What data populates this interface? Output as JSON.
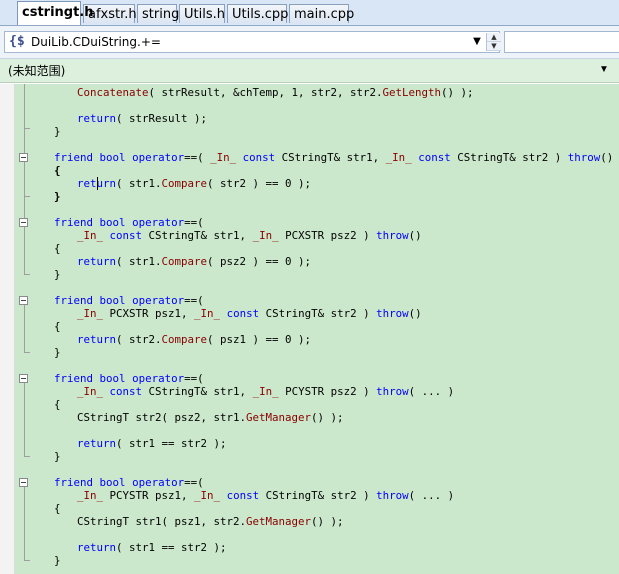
{
  "tabs": [
    {
      "label": "cstringt.h",
      "active": true
    },
    {
      "label": "afxstr.h",
      "active": false
    },
    {
      "label": "string",
      "active": false
    },
    {
      "label": "Utils.h",
      "active": false
    },
    {
      "label": "Utils.cpp",
      "active": false
    },
    {
      "label": "main.cpp",
      "active": false
    }
  ],
  "nav": {
    "scope_icon": "{$",
    "scope_value": "DuiLib.CDuiString.+=",
    "member_value": ""
  },
  "scope_bar": {
    "text": "(未知范围)"
  },
  "colors": {
    "editor_bg": "#cce8cc",
    "keyword": "#0000ff",
    "function": "#880000",
    "sal_macro": "#8b0000"
  },
  "code_lines": {
    "l01": {
      "text": "Concatenate( strResult, &chTemp, 1, str2, str2.GetLength() );"
    },
    "l02": {
      "text": "return( strResult );"
    },
    "l03": {
      "text": "}"
    },
    "l04": {
      "text": "friend bool operator==( _In_ const CStringT& str1, _In_ const CStringT& str2 ) throw()"
    },
    "l05": {
      "text": "{"
    },
    "l06": {
      "text": "return( str1.Compare( str2 ) == 0 );"
    },
    "l07": {
      "text": "}"
    },
    "l08": {
      "text": "friend bool operator==("
    },
    "l09": {
      "text": "_In_ const CStringT& str1, _In_ PCXSTR psz2 ) throw()"
    },
    "l10": {
      "text": "{"
    },
    "l11": {
      "text": "return( str1.Compare( psz2 ) == 0 );"
    },
    "l12": {
      "text": "}"
    },
    "l13": {
      "text": "friend bool operator==("
    },
    "l14": {
      "text": "_In_ PCXSTR psz1, _In_ const CStringT& str2 ) throw()"
    },
    "l15": {
      "text": "{"
    },
    "l16": {
      "text": "return( str2.Compare( psz1 ) == 0 );"
    },
    "l17": {
      "text": "}"
    },
    "l18": {
      "text": "friend bool operator==("
    },
    "l19": {
      "text": "_In_ const CStringT& str1, _In_ PCYSTR psz2 ) throw( ... )"
    },
    "l20": {
      "text": "{"
    },
    "l21": {
      "text": "CStringT str2( psz2, str1.GetManager() );"
    },
    "l22": {
      "text": "return( str1 == str2 );"
    },
    "l23": {
      "text": "}"
    },
    "l24": {
      "text": "friend bool operator==("
    },
    "l25": {
      "text": "_In_ PCYSTR psz1, _In_ const CStringT& str2 ) throw( ... )"
    },
    "l26": {
      "text": "{"
    },
    "l27": {
      "text": "CStringT str1( psz1, str2.GetManager() );"
    },
    "l28": {
      "text": "return( str1 == str2 );"
    },
    "l29": {
      "text": "}"
    }
  }
}
